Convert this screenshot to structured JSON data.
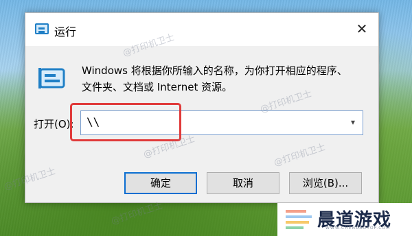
{
  "dialog": {
    "title": "运行",
    "description_line1": "Windows 将根据你所输入的名称，为你打开相应的程序、",
    "description_line2": "文件夹、文档或 Internet 资源。",
    "open_label": "打开(O):",
    "open_value": "\\\\",
    "buttons": {
      "ok": "确定",
      "cancel": "取消",
      "browse": "浏览(B)..."
    }
  },
  "watermark_text": "@打印机卫士",
  "brand": {
    "name": "晨道游戏",
    "subtitle": "WWW.CHENDAOTOP.COM"
  },
  "colors": {
    "highlight": "#e03a3a",
    "focus_border": "#0a6ed1",
    "icon_blue": "#1f7fc6"
  }
}
